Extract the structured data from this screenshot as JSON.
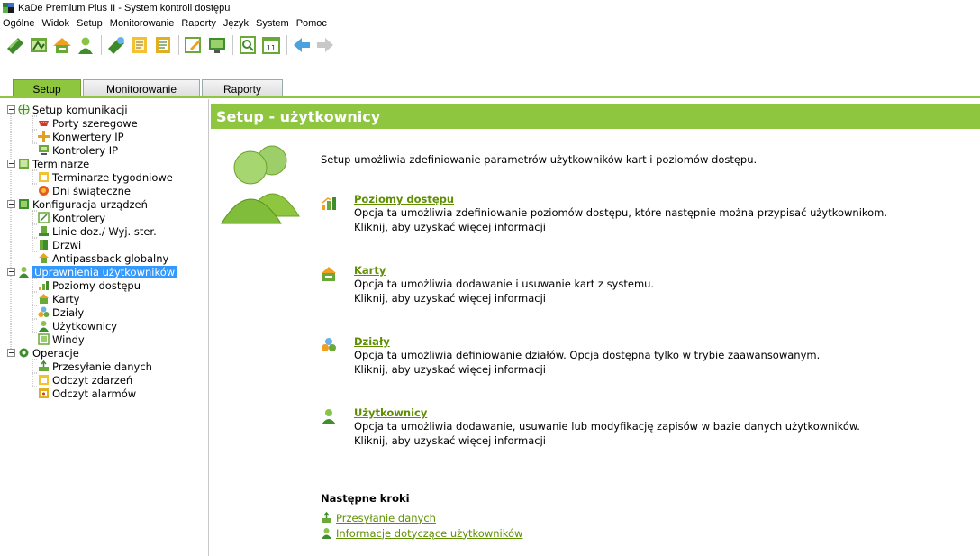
{
  "window": {
    "title": "KaDe Premium Plus II - System kontroli dostępu"
  },
  "menu": [
    "Ogólne",
    "Widok",
    "Setup",
    "Monitorowanie",
    "Raporty",
    "Język",
    "System",
    "Pomoc"
  ],
  "toolbar": {
    "icons": [
      "setup-communication-icon",
      "terminarze-icon",
      "karty-icon",
      "uzytkownicy-icon",
      "przesylanie-icon",
      "odczyt-zdarzen-icon",
      "odczyt-alarmow-icon",
      "edit-icon",
      "monitor-icon",
      "raport-icon",
      "calendar-icon",
      "back-arrow-icon",
      "forward-arrow-icon"
    ]
  },
  "tabs": [
    "Setup",
    "Monitorowanie",
    "Raporty"
  ],
  "tree": {
    "setup_komunikacji": "Setup komunikacji",
    "porty": "Porty szeregowe",
    "konwertery": "Konwertery IP",
    "kontrolery_ip": "Kontrolery IP",
    "terminarze": "Terminarze",
    "terminarze_tyg": "Terminarze tygodniowe",
    "dni_swiateczne": "Dni świąteczne",
    "konfiguracja": "Konfiguracja urządzeń",
    "kontrolery": "Kontrolery",
    "linie": "Linie doz./ Wyj. ster.",
    "drzwi": "Drzwi",
    "antipassback": "Antipassback globalny",
    "uprawnienia": "Uprawnienia użytkowników",
    "poziomy": "Poziomy dostępu",
    "karty": "Karty",
    "dzialy": "Działy",
    "uzytkownicy": "Użytkownicy",
    "windy": "Windy",
    "operacje": "Operacje",
    "przesylanie": "Przesyłanie danych",
    "odczyt_zdarzen": "Odczyt zdarzeń",
    "odczyt_alarmow": "Odczyt alarmów"
  },
  "content": {
    "header": "Setup - użytkownicy",
    "intro": "Setup umożliwia zdefiniowanie parametrów użytkowników kart i poziomów dostępu.",
    "sections": [
      {
        "title": "Poziomy dostępu",
        "desc": "Opcja ta umożliwia zdefiniowanie poziomów dostępu, które następnie można przypisać użytkownikom.",
        "more": "Kliknij, aby uzyskać więcej informacji"
      },
      {
        "title": "Karty",
        "desc": "Opcja ta umożliwia dodawanie i usuwanie kart z systemu.",
        "more": "Kliknij, aby uzyskać więcej informacji"
      },
      {
        "title": "Działy",
        "desc": "Opcja ta umożliwia definiowanie działów. Opcja dostępna tylko w trybie zaawansowanym.",
        "more": "Kliknij, aby uzyskać więcej informacji"
      },
      {
        "title": "Użytkownicy",
        "desc": "Opcja ta umożliwia dodawanie, usuwanie lub modyfikację zapisów w bazie danych użytkowników.",
        "more": "Kliknij, aby uzyskać więcej informacji"
      }
    ],
    "next_steps_title": "Następne kroki",
    "next_links": [
      "Przesyłanie danych",
      "Informacje dotyczące użytkowników"
    ]
  },
  "colors": {
    "accent": "#8fc63f",
    "link": "#5f8f00",
    "selection": "#3399ff"
  }
}
